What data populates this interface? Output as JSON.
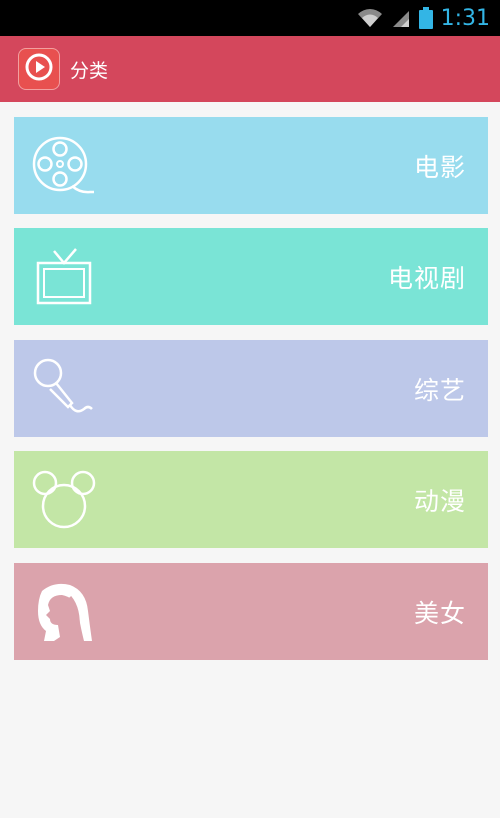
{
  "status_bar": {
    "time": "1:31",
    "icons": [
      "wifi-icon",
      "cell-signal-icon",
      "battery-icon"
    ],
    "color": "#33b5e5"
  },
  "app_bar": {
    "title": "分类",
    "logo_icon": "play-icon",
    "background": "#d4475c"
  },
  "categories": [
    {
      "label": "电影",
      "icon": "film-reel-icon",
      "color": "#98dcee"
    },
    {
      "label": "电视剧",
      "icon": "tv-icon",
      "color": "#7ae4d6"
    },
    {
      "label": "综艺",
      "icon": "microphone-icon",
      "color": "#bdc8e9"
    },
    {
      "label": "动漫",
      "icon": "mickey-ears-icon",
      "color": "#c3e6a6"
    },
    {
      "label": "美女",
      "icon": "woman-profile-icon",
      "color": "#dba3ac"
    }
  ]
}
